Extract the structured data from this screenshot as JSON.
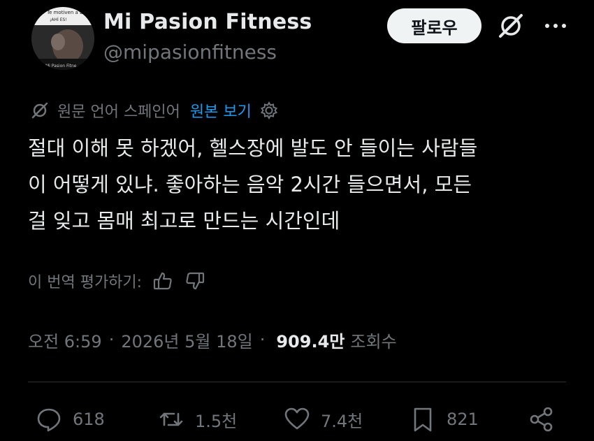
{
  "profile": {
    "name": "Mi Pasion Fitness",
    "handle": "@mipasionfitness",
    "avatar_text_top": "Te motiven a E",
    "avatar_text_mid": "¡AHÍ ES!",
    "avatar_text_bottom": "Mi Pasion Fitne"
  },
  "header": {
    "follow_label": "팔로우",
    "grok_icon": "grok-icon",
    "more_icon": "more-icon"
  },
  "translation": {
    "source_label": "원문 언어 스페인어",
    "show_original": "원본 보기"
  },
  "tweet": {
    "lines": [
      "절대 이해 못 하겠어, 헬스장에 발도 안 들이는 사람들",
      "이 어떻게 있냐. 좋아하는 음악 2시간 들으면서, 모든",
      "걸 잊고 몸매 최고로 만드는 시간인데"
    ]
  },
  "rating": {
    "label": "이 번역 평가하기:"
  },
  "meta": {
    "time": "오전 6:59",
    "date": "2026년 5월 18일",
    "separator": "·",
    "views_count": "909.4만",
    "views_label": "조회수"
  },
  "actions": {
    "replies": "618",
    "reposts": "1.5천",
    "likes": "7.4천",
    "bookmarks": "821"
  },
  "colors": {
    "background": "#000000",
    "text": "#e7e9ea",
    "muted": "#71767b",
    "link": "#1d9bf0",
    "button_bg": "#eff3f4"
  }
}
